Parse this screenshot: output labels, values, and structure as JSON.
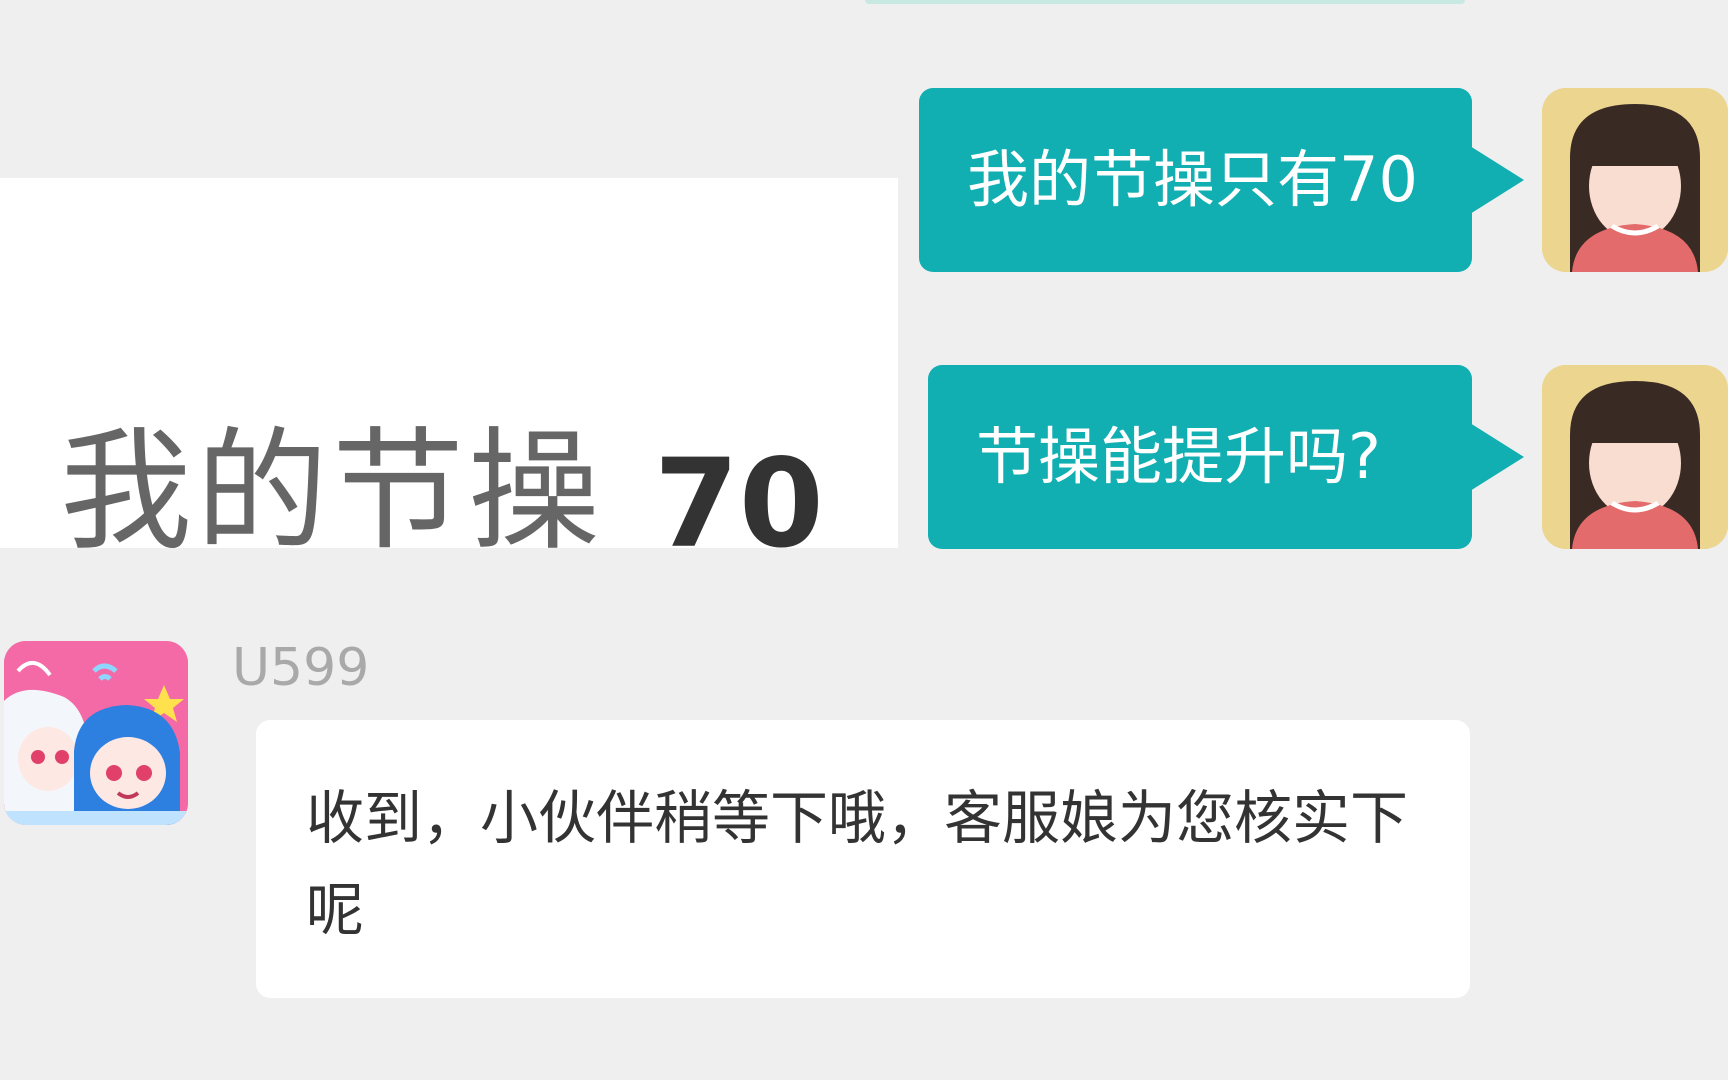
{
  "shared_image": {
    "label": "我的节操",
    "value": "70"
  },
  "messages": {
    "outgoing": [
      {
        "text": "我的节操只有70"
      },
      {
        "text": "节操能提升吗?"
      }
    ],
    "incoming": {
      "sender": "U599",
      "text": "收到，小伙伴稍等下哦，客服娘为您核实下呢"
    }
  },
  "colors": {
    "background": "#efefef",
    "outgoing_bubble": "#11aeb2",
    "incoming_bubble": "#ffffff",
    "sender_name": "#a9a9a9"
  },
  "icons": {
    "user_avatar": "girl-avatar-icon",
    "agent_avatar": "anime-agent-avatar-icon"
  }
}
